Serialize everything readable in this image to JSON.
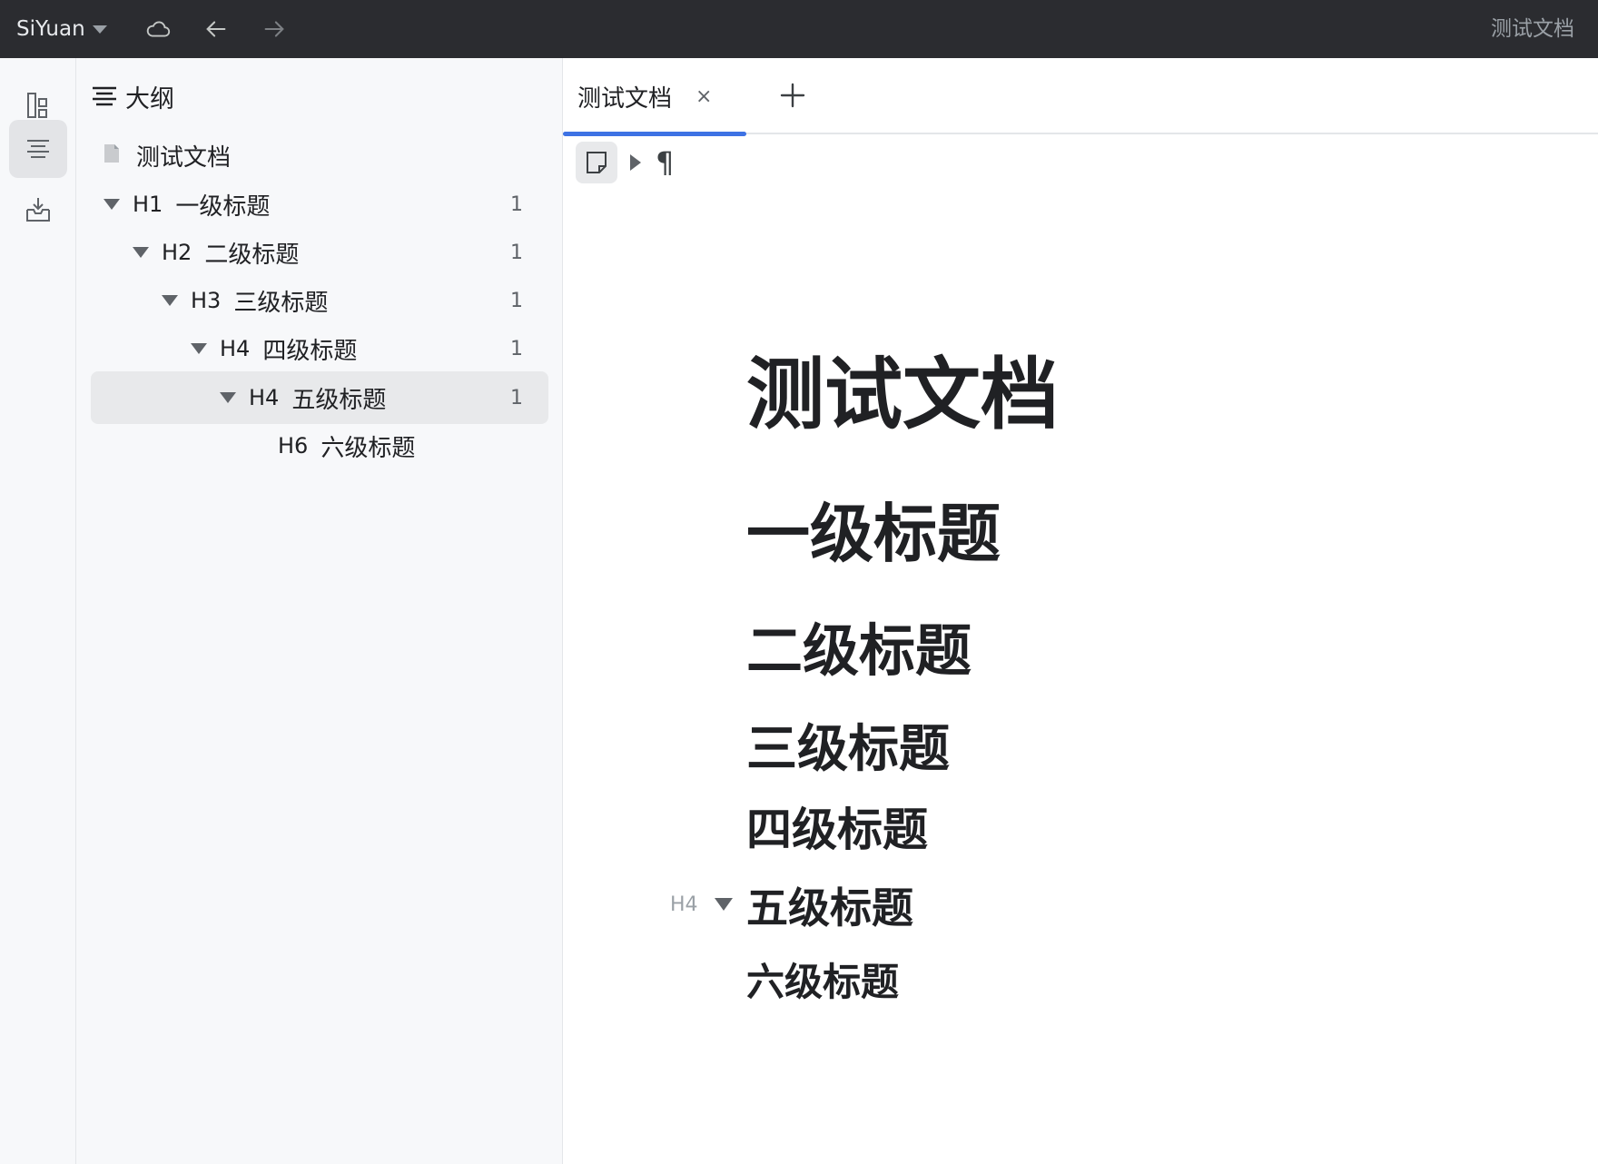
{
  "app": {
    "name": "SiYuan",
    "window_title": "测试文档"
  },
  "toolbar": {
    "sync_icon": "cloud-icon",
    "back_icon": "arrow-left-icon",
    "forward_icon": "arrow-right-icon"
  },
  "dock": {
    "items": [
      "file-tree-icon",
      "outline-icon",
      "inbox-icon"
    ],
    "active": "outline-icon"
  },
  "outline": {
    "title": "大纲",
    "doc": {
      "label": "测试文档"
    },
    "items": [
      {
        "level": "H1",
        "label": "一级标题",
        "count": "1",
        "collapsible": true
      },
      {
        "level": "H2",
        "label": "二级标题",
        "count": "1",
        "collapsible": true
      },
      {
        "level": "H3",
        "label": "三级标题",
        "count": "1",
        "collapsible": true
      },
      {
        "level": "H4",
        "label": "四级标题",
        "count": "1",
        "collapsible": true
      },
      {
        "level": "H4",
        "label": "五级标题",
        "count": "1",
        "collapsible": true,
        "selected": true
      },
      {
        "level": "H6",
        "label": "六级标题",
        "count": "",
        "collapsible": false
      }
    ]
  },
  "editor": {
    "tab": {
      "label": "测试文档",
      "close": "×"
    },
    "breadcrumb": {
      "doc_icon": "document-icon",
      "paragraph_mark": "¶"
    },
    "title": "测试文档",
    "headings": [
      "一级标题",
      "二级标题",
      "三级标题",
      "四级标题",
      "五级标题",
      "六级标题"
    ],
    "gutter_label": "H4"
  },
  "colors": {
    "titlebar": "#2b2c30",
    "accent": "#3d72e4",
    "panel_bg": "#f7f8fa"
  }
}
